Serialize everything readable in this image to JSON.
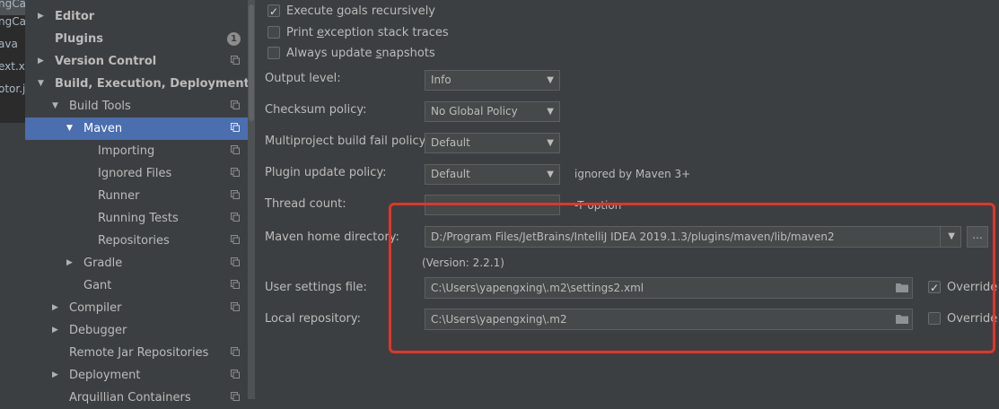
{
  "editor_tabs": [
    "ngCa",
    "ava",
    "ext.xr",
    "otor.ja"
  ],
  "tree": {
    "items": [
      {
        "label": "Editor",
        "depth": 0,
        "arrow": "right",
        "bold": true
      },
      {
        "label": "Plugins",
        "depth": 0,
        "bold": true,
        "badge": "1"
      },
      {
        "label": "Version Control",
        "depth": 0,
        "arrow": "right",
        "bold": true,
        "proj": true
      },
      {
        "label": "Build, Execution, Deployment",
        "depth": 0,
        "arrow": "down",
        "bold": true
      },
      {
        "label": "Build Tools",
        "depth": 1,
        "arrow": "down",
        "proj": true
      },
      {
        "label": "Maven",
        "depth": 2,
        "arrow": "down",
        "selected": true,
        "proj": true
      },
      {
        "label": "Importing",
        "depth": 3,
        "proj": true
      },
      {
        "label": "Ignored Files",
        "depth": 3,
        "proj": true
      },
      {
        "label": "Runner",
        "depth": 3,
        "proj": true
      },
      {
        "label": "Running Tests",
        "depth": 3,
        "proj": true
      },
      {
        "label": "Repositories",
        "depth": 3,
        "proj": true
      },
      {
        "label": "Gradle",
        "depth": 2,
        "arrow": "right",
        "proj": true
      },
      {
        "label": "Gant",
        "depth": 2,
        "proj": true
      },
      {
        "label": "Compiler",
        "depth": 1,
        "arrow": "right",
        "proj": true
      },
      {
        "label": "Debugger",
        "depth": 1,
        "arrow": "right"
      },
      {
        "label": "Remote Jar Repositories",
        "depth": 1,
        "proj": true
      },
      {
        "label": "Deployment",
        "depth": 1,
        "arrow": "right",
        "proj": true
      },
      {
        "label": "Arquillian Containers",
        "depth": 1,
        "proj": true
      }
    ]
  },
  "checkboxes": {
    "execute_goals": {
      "pre": "Execute ",
      "ul": "g",
      "post": "oals recursively",
      "checked": true
    },
    "print_exception": {
      "pre": "Print ",
      "ul": "e",
      "post": "xception stack traces",
      "checked": false
    },
    "update_snapshots": {
      "pre": "Always update ",
      "ul": "s",
      "post": "napshots",
      "checked": false
    }
  },
  "fields": {
    "output_level": {
      "label": "Output level:",
      "value": "Info"
    },
    "checksum_policy": {
      "label": "Checksum policy:",
      "value": "No Global Policy"
    },
    "multiproject_fail": {
      "label": "Multiproject build fail policy:",
      "value": "Default"
    },
    "plugin_update": {
      "label": "Plugin update policy:",
      "value": "Default",
      "note": "ignored by Maven 3+"
    },
    "thread_count": {
      "label": "Thread count:",
      "value": "",
      "note": "-T option"
    },
    "maven_home": {
      "label": "Maven home directory:",
      "value": "D:/Program Files/JetBrains/IntelliJ IDEA 2019.1.3/plugins/maven/lib/maven2",
      "version": "(Version: 2.2.1)",
      "browse": "..."
    },
    "user_settings": {
      "label": "User settings file:",
      "value": "C:\\Users\\yapengxing\\.m2\\settings2.xml",
      "override": "Override",
      "override_checked": true
    },
    "local_repo": {
      "label": "Local repository:",
      "value": "C:\\Users\\yapengxing\\.m2",
      "override": "Override",
      "override_checked": false
    }
  },
  "colors": {
    "highlight": "#e5332a",
    "selection": "#4b6eaf"
  }
}
